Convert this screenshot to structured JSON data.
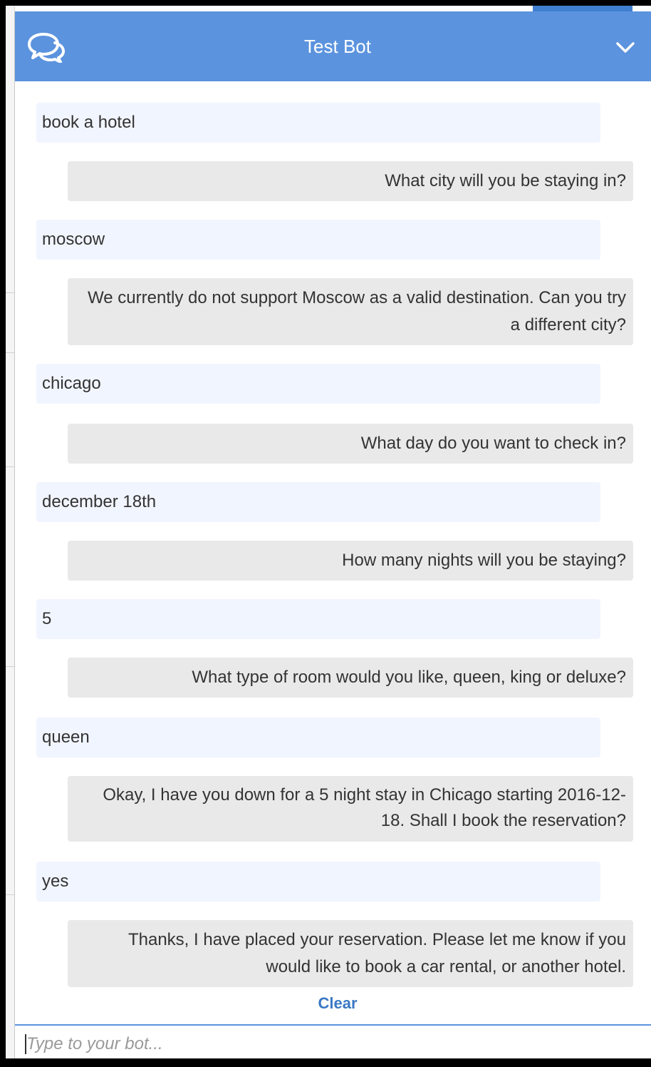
{
  "header": {
    "title": "Test Bot",
    "icon": "chat-bubbles-icon",
    "collapse_icon": "chevron-down-icon",
    "color": "#5b93de"
  },
  "messages": [
    {
      "role": "user",
      "text": "book a hotel"
    },
    {
      "role": "bot",
      "text": "What city will you be staying in?"
    },
    {
      "role": "user",
      "text": "moscow"
    },
    {
      "role": "bot",
      "text": "We currently do not support Moscow as a valid destination. Can you try a different city?"
    },
    {
      "role": "user",
      "text": "chicago"
    },
    {
      "role": "bot",
      "text": "What day do you want to check in?"
    },
    {
      "role": "user",
      "text": "december 18th"
    },
    {
      "role": "bot",
      "text": "How many nights will you be staying?"
    },
    {
      "role": "user",
      "text": "5"
    },
    {
      "role": "bot",
      "text": "What type of room would you like, queen, king or deluxe?"
    },
    {
      "role": "user",
      "text": "queen"
    },
    {
      "role": "bot",
      "text": "Okay, I have you down for a 5 night stay in Chicago starting 2016-12-18. Shall I book the reservation?"
    },
    {
      "role": "user",
      "text": "yes"
    },
    {
      "role": "bot",
      "text": "Thanks, I have placed your reservation. Please let me know if you would like to book a car rental, or another hotel."
    }
  ],
  "footer": {
    "clear_label": "Clear",
    "input_placeholder": "Type to your bot..."
  },
  "colors": {
    "user_bubble": "#f1f5ff",
    "bot_bubble": "#e9e9e9",
    "link": "#3a78c4"
  }
}
